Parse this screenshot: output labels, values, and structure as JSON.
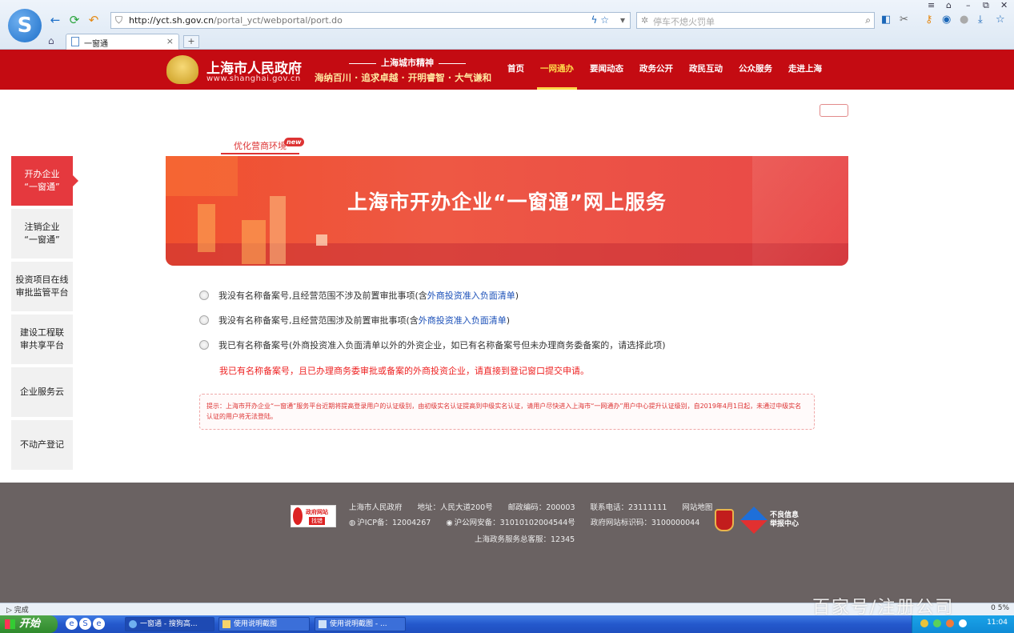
{
  "browser": {
    "url_host": "http://yct.sh.gov.cn",
    "url_path": "/portal_yct/webportal/port.do",
    "search_placeholder": "停车不熄火罚单",
    "tab_title": "一窗通",
    "new_tab": "+",
    "status_left": "完成",
    "status_right": "0 5%"
  },
  "header": {
    "gov_name": "上海市人民政府",
    "gov_url": "www.shanghai.gov.cn",
    "spirit_title": "上海城市精神",
    "spirit_sub": "海纳百川 · 追求卓越 · 开明睿智 · 大气谦和",
    "nav": [
      "首页",
      "一网通办",
      "要闻动态",
      "政务公开",
      "政民互动",
      "公众服务",
      "走进上海"
    ],
    "nav_active_index": 1
  },
  "section_tab": {
    "label": "优化营商环境",
    "badge": "new"
  },
  "sidemenu": [
    {
      "label": "开办企业\n“一窗通”",
      "active": true
    },
    {
      "label": "注销企业\n“一窗通”",
      "active": false
    },
    {
      "label": "投资项目在线\n审批监管平台",
      "active": false
    },
    {
      "label": "建设工程联\n审共享平台",
      "active": false
    },
    {
      "label": "企业服务云",
      "active": false
    },
    {
      "label": "不动产登记",
      "active": false
    }
  ],
  "banner": {
    "title": "上海市开办企业“一窗通”网上服务"
  },
  "options": [
    {
      "pre": "我没有名称备案号,且经营范围不涉及前置审批事项(含",
      "link": "外商投资准入负面清单",
      "post": ")"
    },
    {
      "pre": "我没有名称备案号,且经营范围涉及前置审批事项(含",
      "link": "外商投资准入负面清单",
      "post": ")"
    },
    {
      "pre": "我已有名称备案号(外商投资准入负面清单以外的外资企业，如已有名称备案号但未办理商务委备案的，请选择此项)",
      "link": "",
      "post": ""
    }
  ],
  "warning": "我已有名称备案号，且已办理商务委审批或备案的外商投资企业，请直接到登记窗口提交申请。",
  "tip": "提示：上海市开办企业“一窗通”服务平台近期将提高登录用户的认证级别，由初级实名认证提高到中级实名认证，请用户尽快进入上海市“一网通办”用户中心提升认证级别，自2019年4月1日起，未通过中级实名认证的用户将无法登陆。",
  "footer": {
    "logo_title": "政府网站",
    "logo_sub": "找错",
    "line1": [
      "上海市人民政府",
      "地址：人民大道200号",
      "邮政编码：200003",
      "联系电话：23111111",
      "网站地图"
    ],
    "line2": [
      "沪ICP备：12004267",
      "沪公网安备：31010102004544号",
      "政府网站标识码：3100000044"
    ],
    "line3": "上海政务服务总客服：12345",
    "report": "不良信息\n举报中心"
  },
  "taskbar": {
    "start": "开始",
    "tasks": [
      "一窗通 - 搜狗高...",
      "使用说明截图",
      "使用说明截图 - ..."
    ],
    "clock": "11:04"
  },
  "watermark": "百家号/注册公司"
}
